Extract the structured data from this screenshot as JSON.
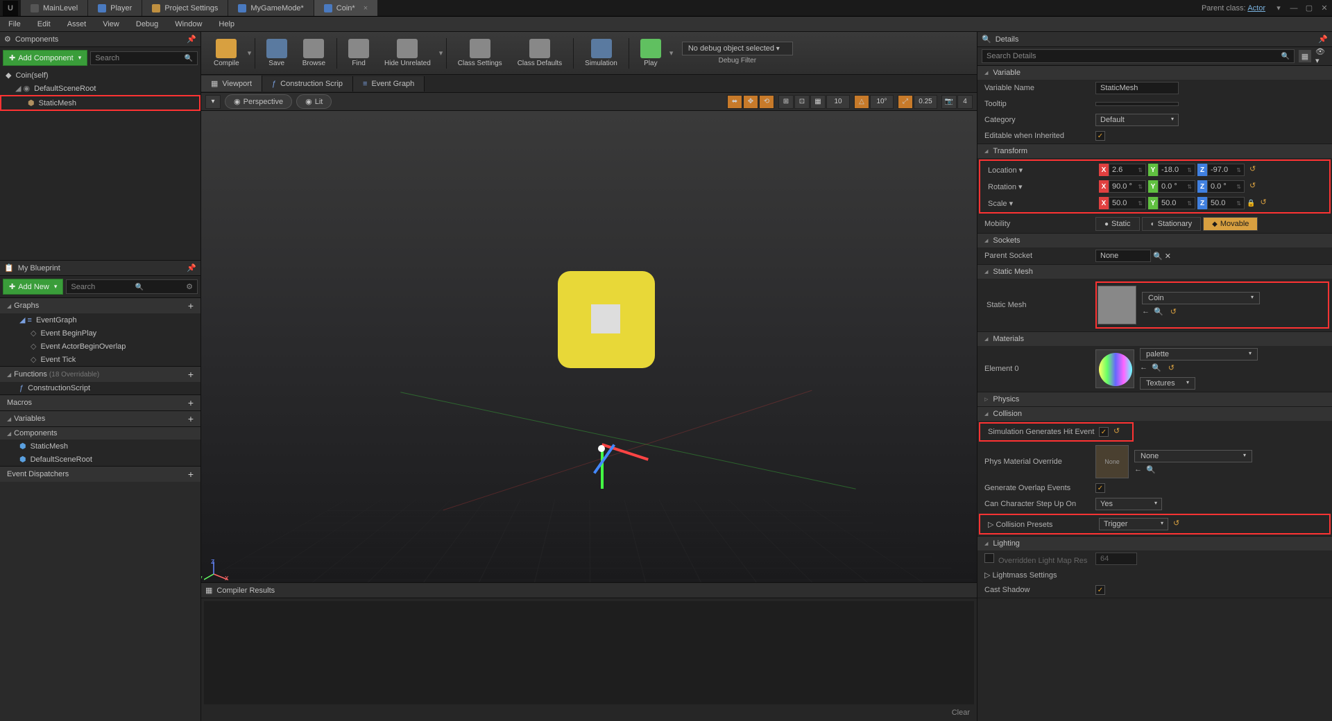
{
  "titlebar": {
    "tabs": [
      {
        "label": "MainLevel"
      },
      {
        "label": "Player"
      },
      {
        "label": "Project Settings"
      },
      {
        "label": "MyGameMode*"
      },
      {
        "label": "Coin*",
        "active": true
      }
    ],
    "parent_class_prefix": "Parent class:",
    "parent_class_link": "Actor"
  },
  "menubar": [
    "File",
    "Edit",
    "Asset",
    "View",
    "Debug",
    "Window",
    "Help"
  ],
  "components": {
    "title": "Components",
    "add_btn": "Add Component",
    "search_placeholder": "Search",
    "items": [
      {
        "label": "Coin(self)",
        "indent": 0
      },
      {
        "label": "DefaultSceneRoot",
        "indent": 1
      },
      {
        "label": "StaticMesh",
        "indent": 2,
        "highlight": true
      }
    ]
  },
  "myblueprint": {
    "title": "My Blueprint",
    "add_btn": "Add New",
    "search_placeholder": "Search",
    "sections": {
      "graphs": {
        "title": "Graphs",
        "items": [
          "EventGraph",
          "Event BeginPlay",
          "Event ActorBeginOverlap",
          "Event Tick"
        ]
      },
      "functions": {
        "title": "Functions",
        "suffix": "(18 Overridable)",
        "items": [
          "ConstructionScript"
        ]
      },
      "macros": {
        "title": "Macros"
      },
      "variables": {
        "title": "Variables"
      },
      "comps": {
        "title": "Components",
        "items": [
          "StaticMesh",
          "DefaultSceneRoot"
        ]
      },
      "dispatchers": {
        "title": "Event Dispatchers"
      }
    }
  },
  "toolbar": {
    "compile": "Compile",
    "save": "Save",
    "browse": "Browse",
    "find": "Find",
    "hide": "Hide Unrelated",
    "csettings": "Class Settings",
    "cdefaults": "Class Defaults",
    "simulation": "Simulation",
    "play": "Play",
    "debug_sel": "No debug object selected",
    "debug_label": "Debug Filter"
  },
  "editor_tabs": [
    {
      "label": "Viewport",
      "active": true
    },
    {
      "label": "Construction Scrip"
    },
    {
      "label": "Event Graph"
    }
  ],
  "vp_toolbar": {
    "persp": "Perspective",
    "lit": "Lit",
    "grid": "10",
    "angle": "10°",
    "scale": "0.25",
    "speed": "4"
  },
  "compiler": {
    "title": "Compiler Results",
    "clear": "Clear"
  },
  "details": {
    "title": "Details",
    "search_placeholder": "Search Details",
    "variable": {
      "head": "Variable",
      "varname_lbl": "Variable Name",
      "varname_val": "StaticMesh",
      "tooltip_lbl": "Tooltip",
      "category_lbl": "Category",
      "category_val": "Default",
      "editable_lbl": "Editable when Inherited"
    },
    "transform": {
      "head": "Transform",
      "location_lbl": "Location",
      "rotation_lbl": "Rotation",
      "scale_lbl": "Scale",
      "loc": {
        "x": "2.6",
        "y": "-18.0",
        "z": "-97.0"
      },
      "rot": {
        "x": "90.0 °",
        "y": "0.0 °",
        "z": "0.0 °"
      },
      "scl": {
        "x": "50.0",
        "y": "50.0",
        "z": "50.0"
      },
      "mobility_lbl": "Mobility",
      "mob_static": "Static",
      "mob_stationary": "Stationary",
      "mob_movable": "Movable"
    },
    "sockets": {
      "head": "Sockets",
      "parent_lbl": "Parent Socket",
      "parent_val": "None"
    },
    "staticmesh": {
      "head": "Static Mesh",
      "label": "Static Mesh",
      "asset": "Coin"
    },
    "materials": {
      "head": "Materials",
      "element_lbl": "Element 0",
      "asset": "palette",
      "textures": "Textures"
    },
    "physics": {
      "head": "Physics"
    },
    "collision": {
      "head": "Collision",
      "simhit_lbl": "Simulation Generates Hit Event",
      "physmat_lbl": "Phys Material Override",
      "physmat_val": "None",
      "overlap_lbl": "Generate Overlap Events",
      "stepup_lbl": "Can Character Step Up On",
      "stepup_val": "Yes",
      "preset_lbl": "Collision Presets",
      "preset_val": "Trigger"
    },
    "lighting": {
      "head": "Lighting",
      "overridden_lbl": "Overridden Light Map Res",
      "overridden_val": "64",
      "lightmass": "Lightmass Settings",
      "castshadow_lbl": "Cast Shadow"
    }
  }
}
